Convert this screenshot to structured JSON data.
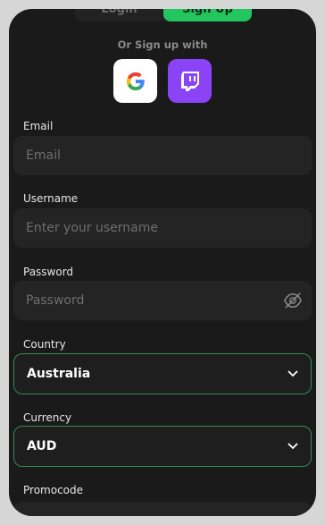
{
  "tabs": {
    "login": "Login",
    "signup": "Sign Up"
  },
  "social": {
    "caption": "Or Sign up with",
    "google_icon": "google-icon",
    "twitch_icon": "twitch-icon"
  },
  "form": {
    "email": {
      "label": "Email",
      "placeholder": "Email"
    },
    "username": {
      "label": "Username",
      "placeholder": "Enter your username"
    },
    "password": {
      "label": "Password",
      "placeholder": "Password",
      "toggle_icon": "eye-off-icon"
    },
    "country": {
      "label": "Country",
      "value": "Australia"
    },
    "currency": {
      "label": "Currency",
      "value": "AUD"
    },
    "promocode": {
      "label": "Promocode"
    }
  },
  "colors": {
    "accent": "#22c55e",
    "background": "#1a1a1a",
    "input_bg": "#242424",
    "twitch": "#8b44f5"
  }
}
